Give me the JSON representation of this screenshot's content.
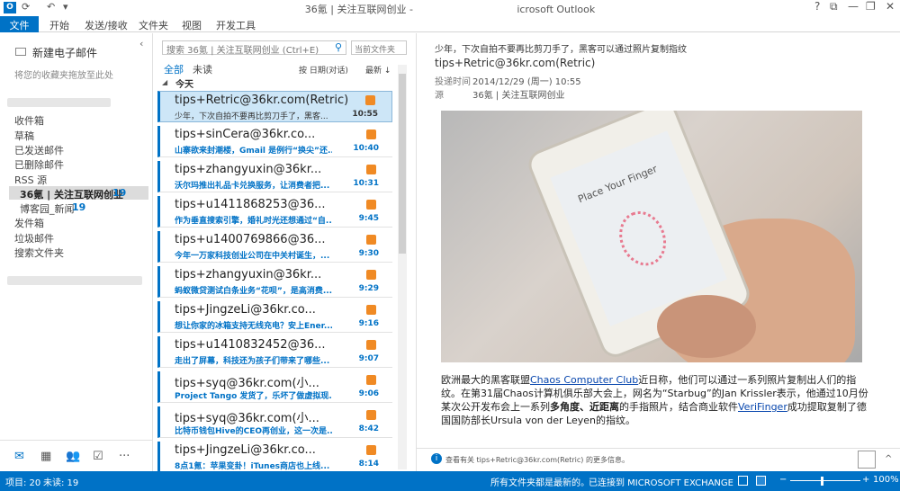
{
  "titlebar": {
    "title": "36氪 | 关注互联网创业 -                                 icrosoft Outlook",
    "question": "?",
    "restore": "⧉",
    "minimize": "—",
    "maximize": "❐",
    "close": "✕"
  },
  "tabs": [
    "文件",
    "开始",
    "发送/接收",
    "文件夹",
    "视图",
    "开发工具"
  ],
  "nav": {
    "new_mail": "新建电子邮件",
    "favorites_hint": "将您的收藏夹拖放至此处",
    "collapse": "‹",
    "folders": [
      "收件箱",
      "草稿",
      "已发送邮件",
      "已删除邮件"
    ],
    "rss_root": "RSS 源",
    "rss_feed_1": "36氪 | 关注互联网创业",
    "rss_feed_1_count": "19",
    "rss_feed_2": "博客园_新闻",
    "rss_feed_2_count": "19",
    "folders2": [
      "发件箱",
      "垃圾邮件",
      "搜索文件夹"
    ],
    "bottom_icons": [
      "mail-icon",
      "calendar-icon",
      "people-icon",
      "tasks-icon",
      "more-icon"
    ],
    "more": "···"
  },
  "list": {
    "search_placeholder": "搜索 36氪 | 关注互联网创业 (Ctrl+E)",
    "scope": "当前文件夹",
    "filter_all": "全部",
    "filter_unread": "未读",
    "sort": "按 日期(对话)",
    "sort_order": "最新 ↓",
    "group_today": "今天",
    "messages": [
      {
        "from": "tips+Retric@36kr.com(Retric)",
        "subject": "少年，下次自拍不要再比剪刀手了，黑客...",
        "time": "10:55"
      },
      {
        "from": "tips+sinCera@36kr.co...",
        "subject": "山寨欲来封潮楼，Gmail 是例行“换尖”还...",
        "time": "10:40"
      },
      {
        "from": "tips+zhangyuxin@36kr...",
        "subject": "沃尔玛推出礼品卡兑换服务，让消费者把...",
        "time": "10:31"
      },
      {
        "from": "tips+u1411868253@36...",
        "subject": "作为垂直搜索引擎，婚礼时光还想通过“自...",
        "time": "9:45"
      },
      {
        "from": "tips+u1400769866@36...",
        "subject": "今年一万家科技创业公司在中关村诞生，...",
        "time": "9:30"
      },
      {
        "from": "tips+zhangyuxin@36kr...",
        "subject": "蚂蚁微贷测试白条业务“花呗”，是高消费...",
        "time": "9:29"
      },
      {
        "from": "tips+JingzeLi@36kr.co...",
        "subject": "想让你家的冰箱支持无线充电？安上Ener...",
        "time": "9:16"
      },
      {
        "from": "tips+u1410832452@36...",
        "subject": "走出了屏幕，科技还为孩子们带来了哪些...",
        "time": "9:07"
      },
      {
        "from": "tips+syq@36kr.com(小...",
        "subject": "Project Tango 发货了，乐坏了做虚拟现...",
        "time": "9:06"
      },
      {
        "from": "tips+syq@36kr.com(小...",
        "subject": "比特币钱包Hive的CEO再创业，这一次是...",
        "time": "8:42"
      },
      {
        "from": "tips+JingzeLi@36kr.co...",
        "subject": "8点1氪：苹果变卦！iTunes商店也上线...",
        "time": "8:14"
      }
    ]
  },
  "reading": {
    "subject": "少年，下次自拍不要再比剪刀手了，黑客可以通过照片复制指纹",
    "from": "tips+Retric@36kr.com(Retric)",
    "sent_label": "投递时间",
    "sent_value": "2014/12/29 (周一) 10:55",
    "source_label": "源",
    "source_value": "36氪 | 关注互联网创业",
    "phone_screen_text": "Place Your Finger",
    "body_1": "欧洲最大的黑客联盟",
    "body_link_1": "Chaos Computer Club",
    "body_2": "近日称，他们可以通过一系列照片复制出人们的指纹。在第31届Chaos计算机俱乐部大会上，网名为“Starbug”的Jan Krissler表示，他通过10月份某次公开发布会上一系列",
    "body_bold_1": "多角度、近距离",
    "body_3": "的手指照片，结合商业软件",
    "body_link_2": "VeriFinger",
    "body_4": "成功提取复制了德国国防部长Ursula von der Leyen的指纹。",
    "footer_text": "查看有关 tips+Retric@36kr.com(Retric) 的更多信息。",
    "footer_chevron": "^"
  },
  "status": {
    "items": "项目: 20",
    "unread": "未读: 19",
    "sync": "所有文件夹都是最新的。",
    "connection": "已连接到 MICROSOFT EXCHANGE",
    "zoom": "100%",
    "zoom_minus": "−",
    "zoom_plus": "+"
  },
  "colors": {
    "accent": "#0072c6",
    "rss": "#f08a24",
    "selected": "#cde6f7"
  }
}
